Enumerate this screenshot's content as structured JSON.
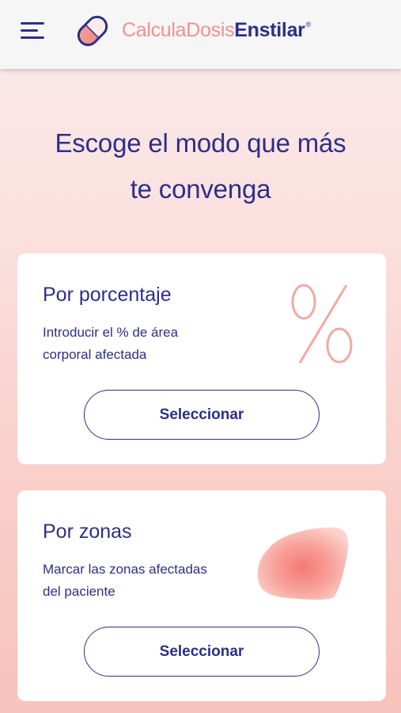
{
  "header": {
    "menu_icon": "hamburger-menu-icon",
    "logo_icon": "pill-logo-icon",
    "brand_light": "CalculaDosis",
    "brand_bold": "Enstilar",
    "brand_registered": "®"
  },
  "main": {
    "headline_line1": "Escoge el modo que más",
    "headline_line2": "te convenga"
  },
  "cards": [
    {
      "title": "Por porcentaje",
      "description": "Introducir el % de área corporal afectada",
      "button_label": "Seleccionar",
      "icon": "percent-icon"
    },
    {
      "title": "Por zonas",
      "description": "Marcar las zonas afectadas del paciente",
      "button_label": "Seleccionar",
      "icon": "body-zone-icon"
    }
  ],
  "colors": {
    "primary": "#2d2f88",
    "accent": "#f0928d",
    "background_top": "#fbeaea",
    "background_bottom": "#f8c3bc"
  }
}
